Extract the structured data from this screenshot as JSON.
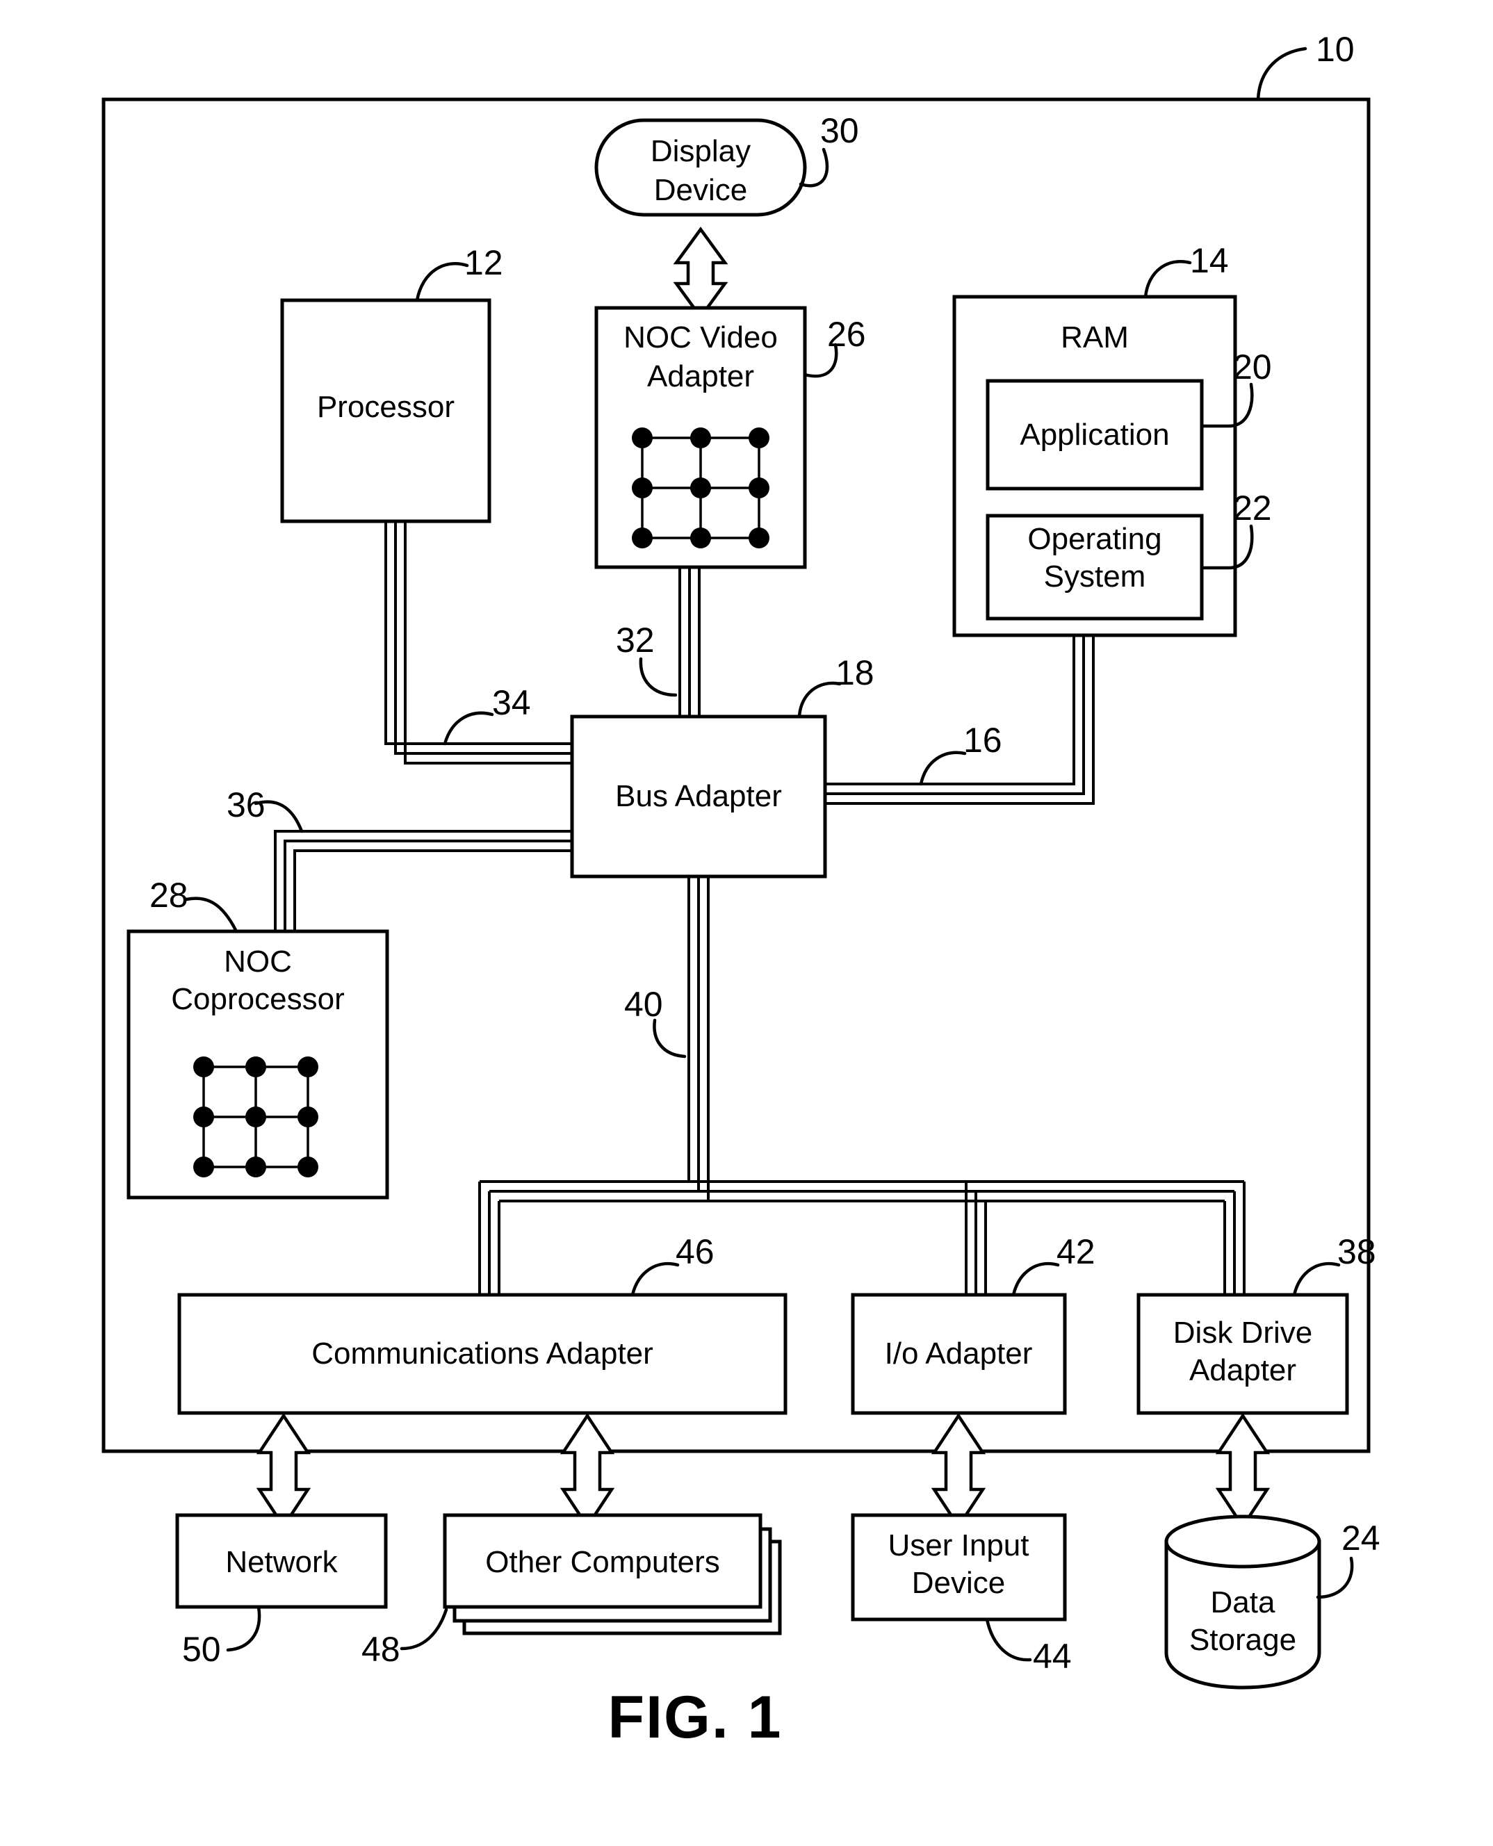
{
  "figure": {
    "caption": "FIG. 1",
    "system_ref": "10"
  },
  "blocks": {
    "display_device": {
      "label_line1": "Display",
      "label_line2": "Device",
      "ref": "30"
    },
    "processor": {
      "label": "Processor",
      "ref": "12"
    },
    "noc_video_adapter": {
      "label_line1": "NOC Video",
      "label_line2": "Adapter",
      "ref": "26"
    },
    "ram": {
      "label": "RAM",
      "ref": "14"
    },
    "application": {
      "label": "Application",
      "ref": "20"
    },
    "operating_system": {
      "label_line1": "Operating",
      "label_line2": "System",
      "ref": "22"
    },
    "bus_adapter": {
      "label": "Bus Adapter",
      "ref": "18"
    },
    "noc_coprocessor": {
      "label_line1": "NOC",
      "label_line2": "Coprocessor",
      "ref": "28"
    },
    "communications_adapter": {
      "label": "Communications Adapter",
      "ref": "46"
    },
    "io_adapter": {
      "label": "I/o Adapter",
      "ref": "42"
    },
    "disk_drive_adapter": {
      "label_line1": "Disk Drive",
      "label_line2": "Adapter",
      "ref": "38"
    },
    "network": {
      "label": "Network",
      "ref": "50"
    },
    "other_computers": {
      "label": "Other Computers",
      "ref": "48"
    },
    "user_input_device": {
      "label_line1": "User Input",
      "label_line2": "Device",
      "ref": "44"
    },
    "data_storage": {
      "label_line1": "Data",
      "label_line2": "Storage",
      "ref": "24"
    }
  },
  "buses": {
    "memory_bus": {
      "ref": "16"
    },
    "video_bus": {
      "ref": "32"
    },
    "front_side_bus": {
      "ref": "34"
    },
    "coprocessor_bus": {
      "ref": "36"
    },
    "expansion_bus": {
      "ref": "40"
    }
  },
  "colors": {
    "line": "#000000",
    "background": "#ffffff",
    "node": "#000000"
  }
}
